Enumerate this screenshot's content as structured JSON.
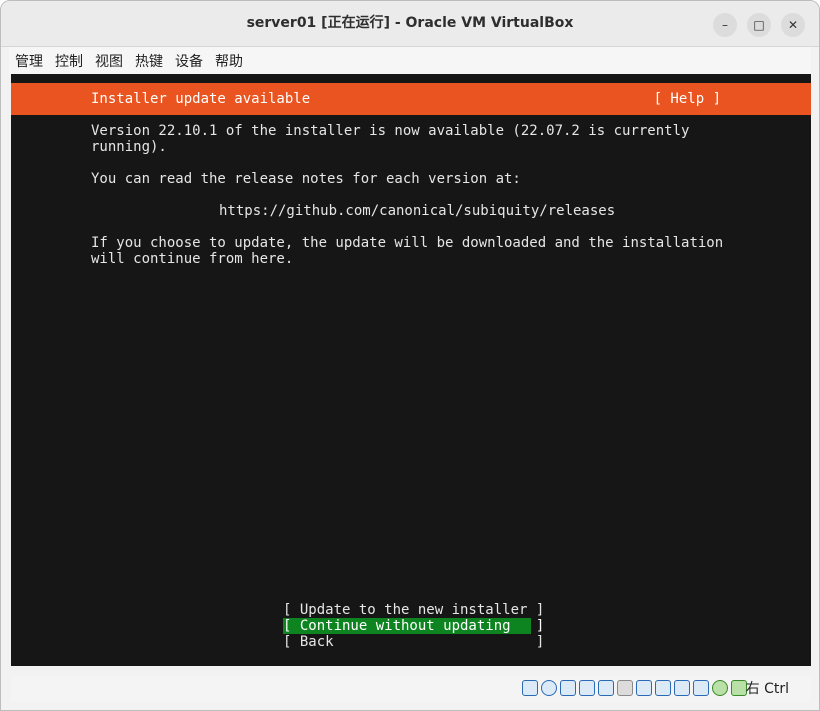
{
  "window": {
    "title": "server01 [正在运行] - Oracle VM VirtualBox",
    "controls": {
      "minimize": "–",
      "maximize": "□",
      "close": "✕"
    }
  },
  "menubar": {
    "items": [
      "管理",
      "控制",
      "视图",
      "热键",
      "设备",
      "帮助"
    ]
  },
  "installer": {
    "header_title": "Installer update available",
    "help_label": "[ Help ]",
    "body": {
      "line1": "Version 22.10.1 of the installer is now available (22.07.2 is currently\nrunning).",
      "line2": "You can read the release notes for each version at:",
      "url": "https://github.com/canonical/subiquity/releases",
      "line3": "If you choose to update, the update will be downloaded and the installation\nwill continue from here."
    },
    "options": [
      {
        "label": "[ Update to the new installer ]",
        "selected": false
      },
      {
        "label": "[ Continue without updating   ]",
        "selected": true
      },
      {
        "label": "[ Back                        ]",
        "selected": false
      }
    ],
    "colors": {
      "header_bg": "#e95420",
      "selected_bg": "#0e8420",
      "screen_bg": "#161616"
    }
  },
  "statusbar": {
    "icons": [
      "hard-disk-icon",
      "optical-drive-icon",
      "audio-icon",
      "network-icon",
      "usb-icon",
      "shared-folders-icon",
      "display-icon",
      "video-capture-icon",
      "recording-icon",
      "cpu-icon",
      "mouse-integration-icon",
      "keyboard-icon"
    ],
    "host_key": "右 Ctrl"
  }
}
